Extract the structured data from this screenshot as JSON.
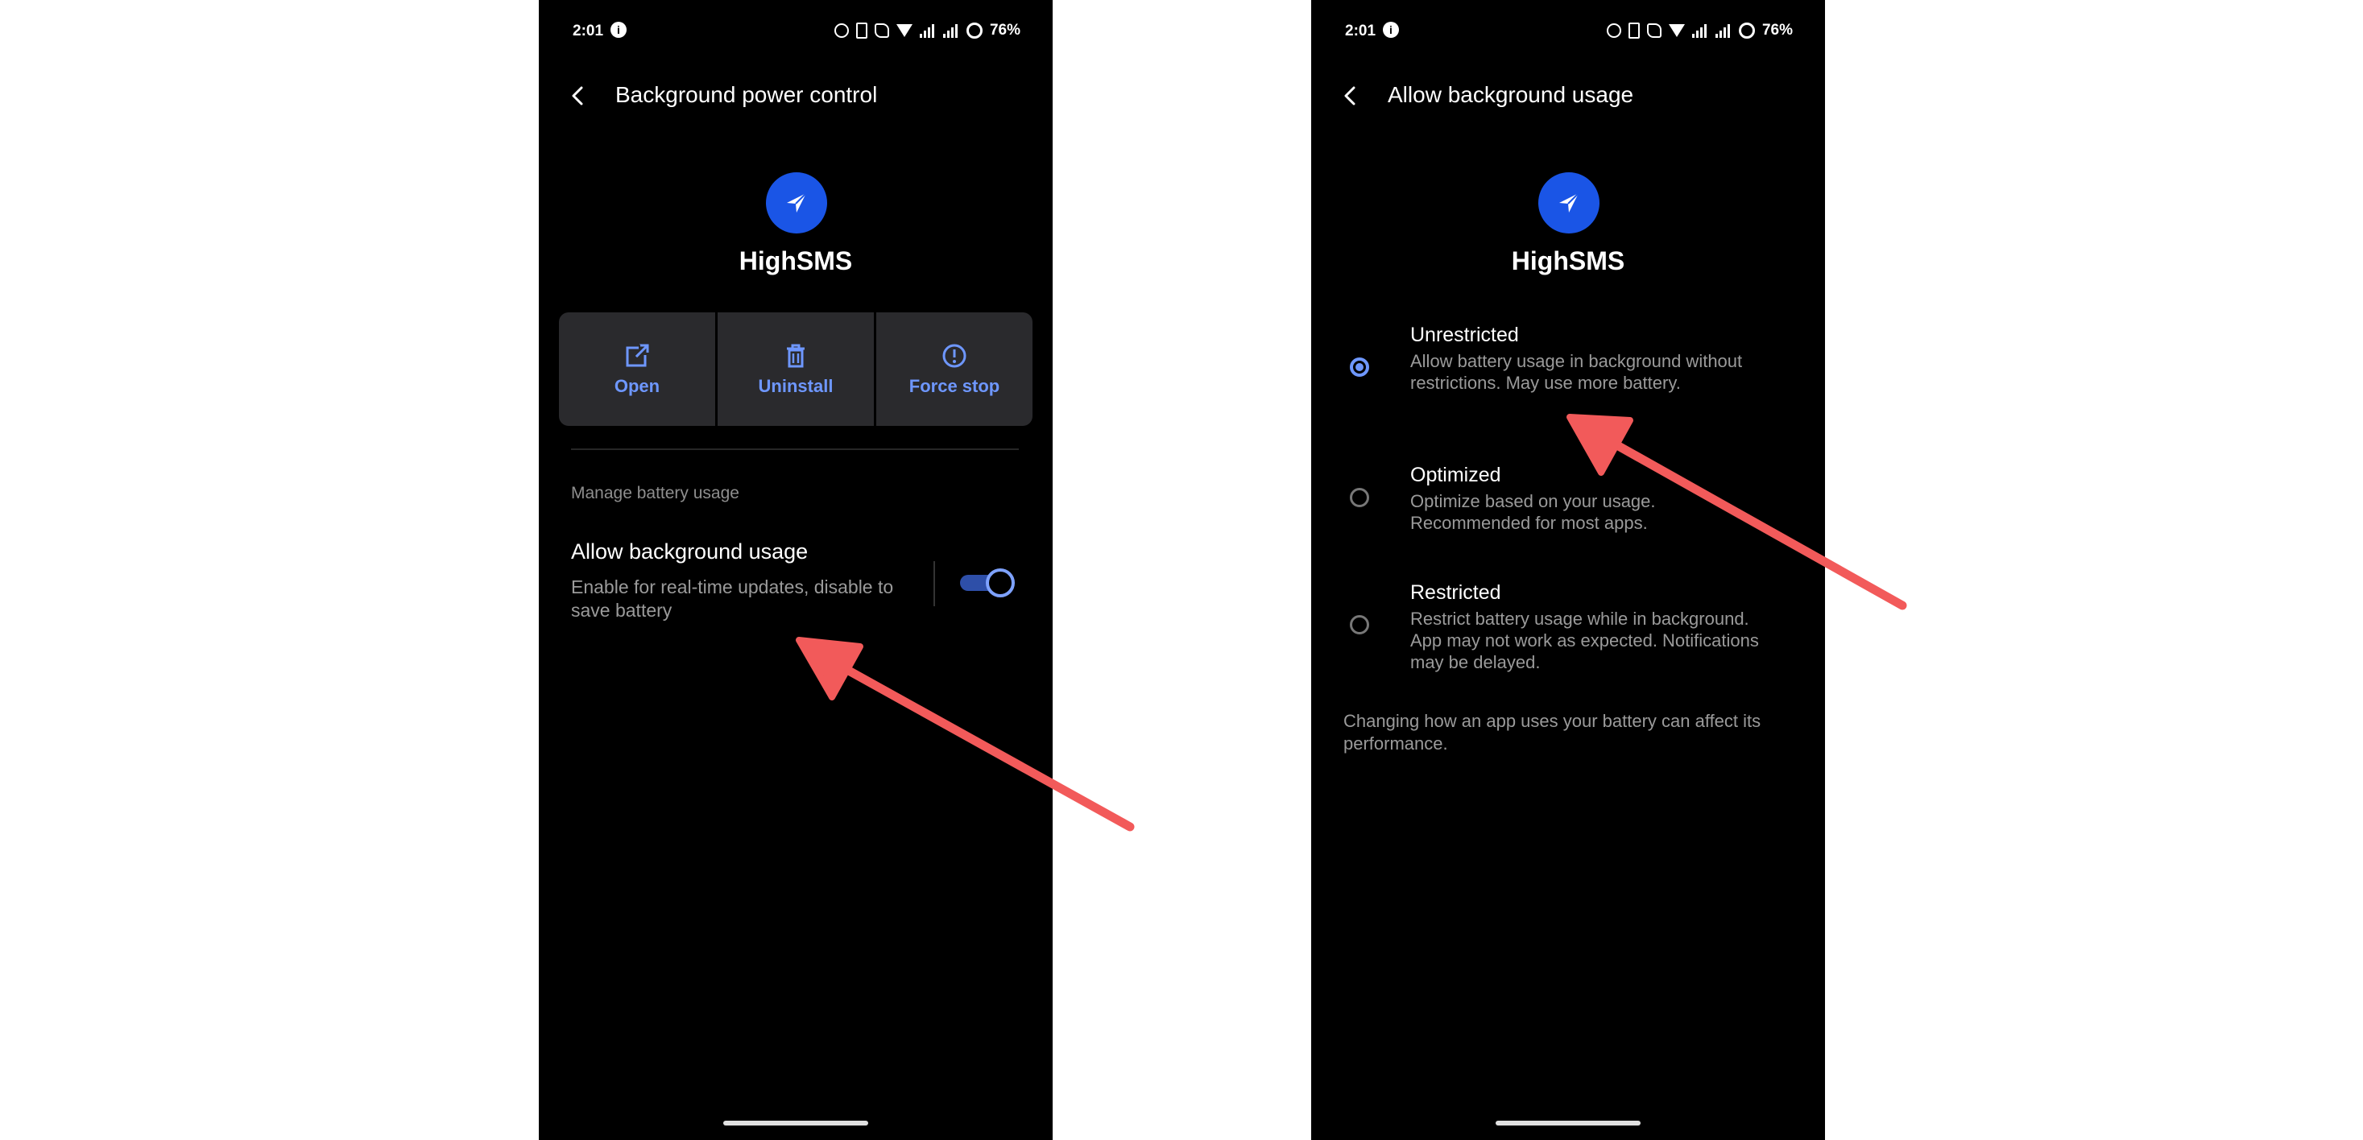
{
  "colors": {
    "accent": "#6e97ff",
    "app_icon": "#1a55e6",
    "annotation_arrow": "#f25a5a"
  },
  "status_bar": {
    "time": "2:01",
    "info": "i",
    "battery": "76%"
  },
  "left": {
    "title": "Background power control",
    "app_name": "HighSMS",
    "actions": {
      "open": "Open",
      "uninstall": "Uninstall",
      "force_stop": "Force stop"
    },
    "section": "Manage battery usage",
    "setting": {
      "title": "Allow background usage",
      "desc": "Enable for real-time updates, disable to save battery",
      "enabled": true
    }
  },
  "right": {
    "title": "Allow background usage",
    "app_name": "HighSMS",
    "options": [
      {
        "title": "Unrestricted",
        "desc": "Allow battery usage in background without restrictions. May use more battery.",
        "selected": true
      },
      {
        "title": "Optimized",
        "desc": "Optimize based on your usage. Recommended for most apps.",
        "selected": false
      },
      {
        "title": "Restricted",
        "desc": "Restrict battery usage while in background. App may not work as expected. Notifications may be delayed.",
        "selected": false
      }
    ],
    "footnote": "Changing how an app uses your battery can affect its performance."
  }
}
